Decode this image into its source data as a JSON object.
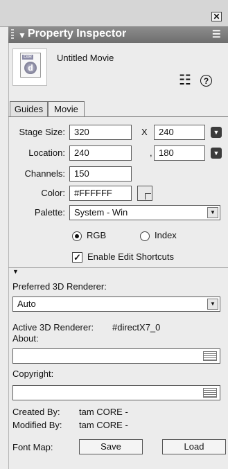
{
  "window": {
    "close_glyph": "✕"
  },
  "panel": {
    "title": "Property Inspector",
    "menu_icon": "options-menu-icon"
  },
  "movie": {
    "name": "Untitled Movie",
    "thumb_tag": "DIR",
    "thumb_glyph": "d"
  },
  "tabs": [
    {
      "label": "Guides",
      "selected": false
    },
    {
      "label": "Movie",
      "selected": true
    }
  ],
  "stage": {
    "stage_size_label": "Stage Size:",
    "width": "320",
    "x_sep": "X",
    "height": "240",
    "location_label": "Location:",
    "loc_x": "240",
    "loc_sep": ",",
    "loc_y": "180",
    "channels_label": "Channels:",
    "channels": "150",
    "color_label": "Color:",
    "color": "#FFFFFF",
    "palette_label": "Palette:",
    "palette": "System - Win"
  },
  "mode": {
    "rgb_label": "RGB",
    "index_label": "Index",
    "selected": "RGB"
  },
  "shortcuts": {
    "label": "Enable Edit Shortcuts",
    "checked": true
  },
  "renderer": {
    "preferred_label": "Preferred 3D Renderer:",
    "preferred": "Auto",
    "active_label": "Active 3D Renderer:",
    "active_value": "#directX7_0"
  },
  "about": {
    "label": "About:",
    "value": ""
  },
  "copyright": {
    "label": "Copyright:",
    "value": ""
  },
  "credits": {
    "created_label": "Created By:",
    "created_value": "tam CORE -",
    "modified_label": "Modified By:",
    "modified_value": "tam CORE -"
  },
  "fontmap": {
    "label": "Font Map:",
    "save": "Save",
    "load": "Load"
  }
}
